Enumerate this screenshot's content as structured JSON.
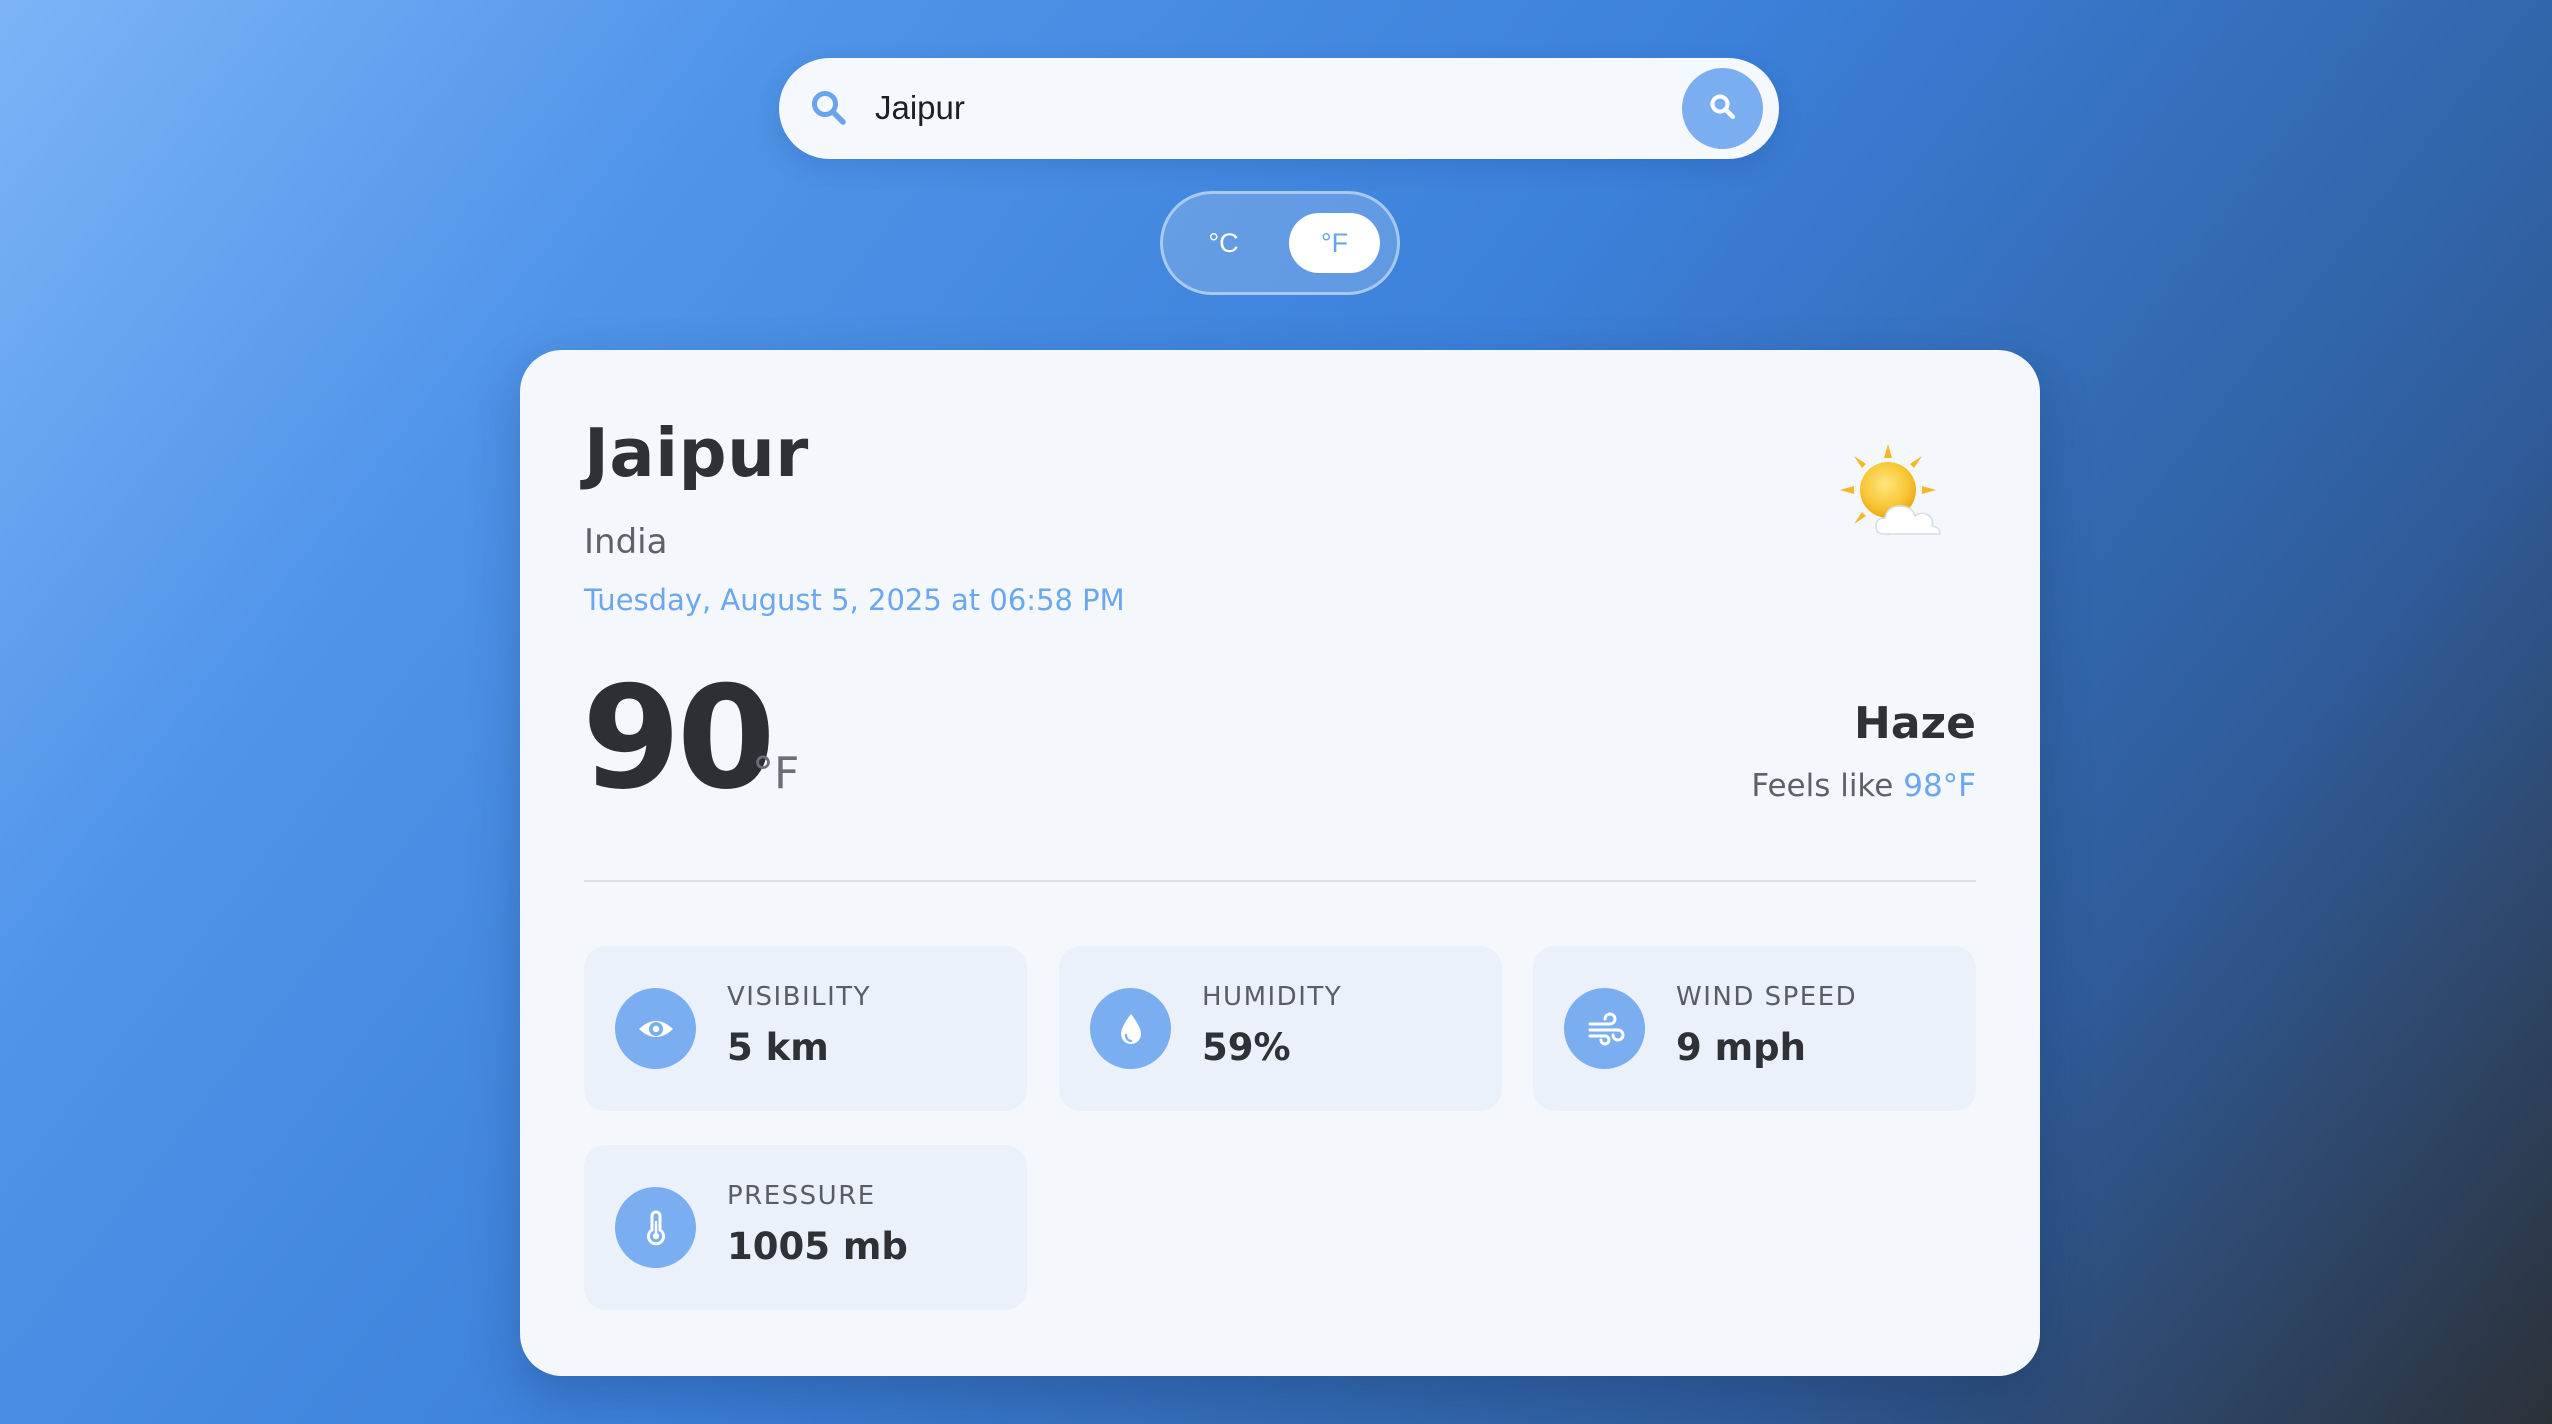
{
  "search": {
    "value": "Jaipur",
    "icon": "search-icon",
    "button_icon": "search-icon"
  },
  "unit_toggle": {
    "celsius_label": "°C",
    "fahrenheit_label": "°F",
    "selected": "°F"
  },
  "weather": {
    "city": "Jaipur",
    "country": "India",
    "datetime": "Tuesday, August 5, 2025 at 06:58 PM",
    "icon": "sun-behind-cloud-icon",
    "temperature": "90",
    "temperature_unit": "°F",
    "condition": "Haze",
    "feels_like_label": "Feels like",
    "feels_like_value": "98°F"
  },
  "stats": [
    {
      "label": "VISIBILITY",
      "value": "5 km",
      "icon": "eye-icon"
    },
    {
      "label": "HUMIDITY",
      "value": "59%",
      "icon": "water-drop-icon"
    },
    {
      "label": "WIND SPEED",
      "value": "9 mph",
      "icon": "wind-icon"
    },
    {
      "label": "PRESSURE",
      "value": "1005 mb",
      "icon": "thermometer-icon"
    }
  ],
  "colors": {
    "accent": "#7aaef0",
    "accent_text": "#6ba7ee",
    "card_background": "#f4f7fb",
    "text_primary": "#2e3136"
  }
}
